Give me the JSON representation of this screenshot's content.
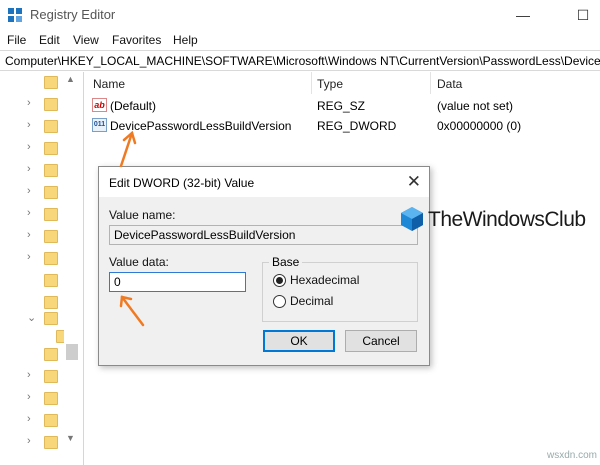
{
  "window": {
    "title": "Registry Editor",
    "minimize_glyph": "—",
    "maximize_glyph": "☐",
    "icon": "registry-editor-icon"
  },
  "menu": {
    "items": [
      "File",
      "Edit",
      "View",
      "Favorites",
      "Help"
    ]
  },
  "address_bar": {
    "path": "Computer\\HKEY_LOCAL_MACHINE\\SOFTWARE\\Microsoft\\Windows NT\\CurrentVersion\\PasswordLess\\Device"
  },
  "tree": {
    "chevron_collapsed": "›",
    "chevron_expanded": "⌄",
    "scroll_up": "▲",
    "scroll_down": "▼"
  },
  "list": {
    "columns": {
      "name": "Name",
      "type": "Type",
      "data": "Data"
    },
    "rows": [
      {
        "icon_label": "ab",
        "icon": "string-value-icon",
        "name": "(Default)",
        "type": "REG_SZ",
        "data": "(value not set)"
      },
      {
        "icon_label": "011",
        "icon": "dword-value-icon",
        "name": "DevicePasswordLessBuildVersion",
        "type": "REG_DWORD",
        "data": "0x00000000 (0)"
      }
    ]
  },
  "dialog": {
    "title": "Edit DWORD (32-bit) Value",
    "close_glyph": "✕",
    "value_name_label": "Value name:",
    "value_name": "DevicePasswordLessBuildVersion",
    "value_data_label": "Value data:",
    "value_data": "0",
    "base_label": "Base",
    "base_options": [
      "Hexadecimal",
      "Decimal"
    ],
    "base_selected": "Hexadecimal",
    "ok_label": "OK",
    "cancel_label": "Cancel"
  },
  "watermark": {
    "text": "TheWindowsClub",
    "site": "wsxdn.com"
  },
  "colors": {
    "accent": "#0078d7",
    "annotation_arrow": "#f07a22",
    "folder": "#f7d77a"
  }
}
